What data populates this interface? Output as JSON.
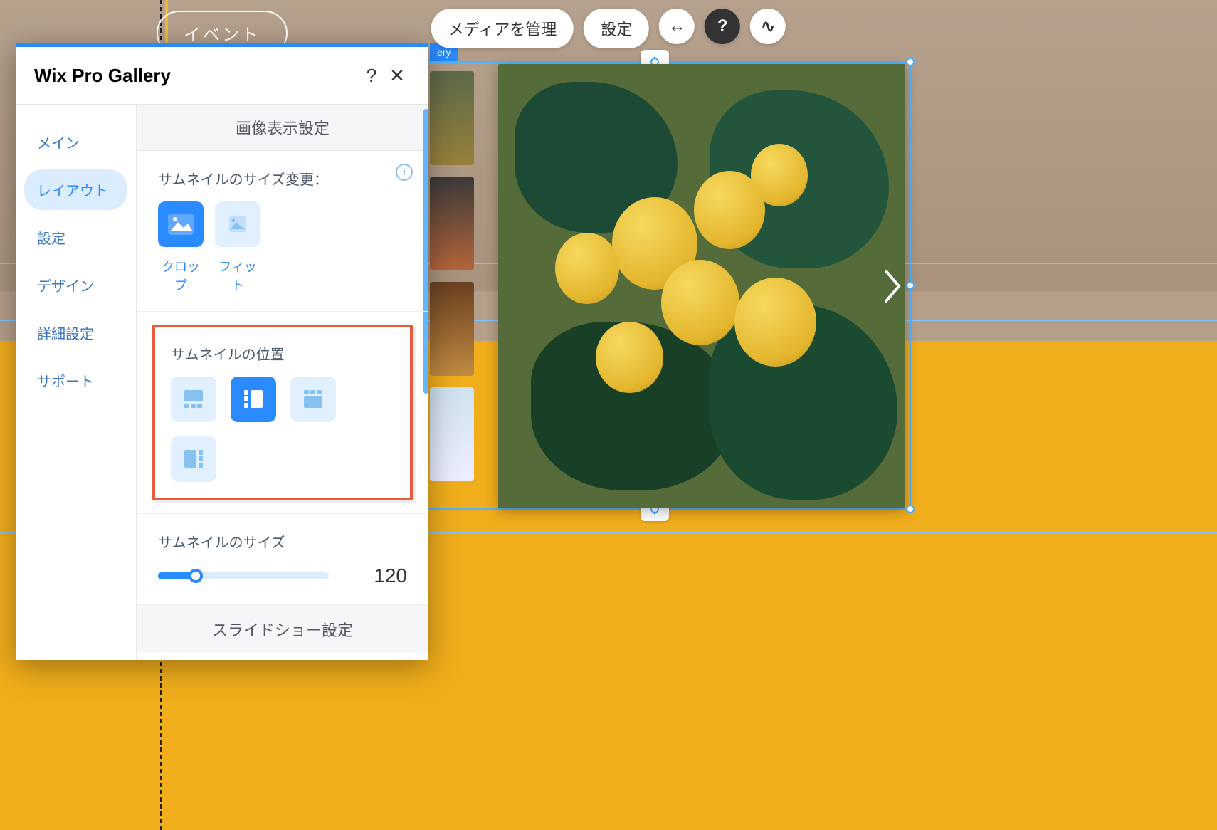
{
  "canvas": {
    "event_chip": "イベント",
    "selection_tag": "ery"
  },
  "toolbar": {
    "manage_media": "メディアを管理",
    "settings": "設定",
    "stretch_tooltip": "↔",
    "help_tooltip": "?",
    "animate_tooltip": "∿"
  },
  "panel": {
    "title": "Wix Pro Gallery",
    "help": "?",
    "close": "✕",
    "sidebar": [
      {
        "label": "メイン",
        "active": false
      },
      {
        "label": "レイアウト",
        "active": true
      },
      {
        "label": "設定",
        "active": false
      },
      {
        "label": "デザイン",
        "active": false
      },
      {
        "label": "詳細設定",
        "active": false
      },
      {
        "label": "サポート",
        "active": false
      }
    ],
    "section_header": "画像表示設定",
    "thumb_resize": {
      "label": "サムネイルのサイズ変更：",
      "crop": "クロップ",
      "fit": "フィット",
      "selected": "crop"
    },
    "thumb_position": {
      "label": "サムネイルの位置",
      "options": [
        "bottom",
        "left",
        "top",
        "right"
      ],
      "selected": "left"
    },
    "thumb_size": {
      "label": "サムネイルのサイズ",
      "value": "120"
    },
    "footer": "スライドショー設定"
  }
}
